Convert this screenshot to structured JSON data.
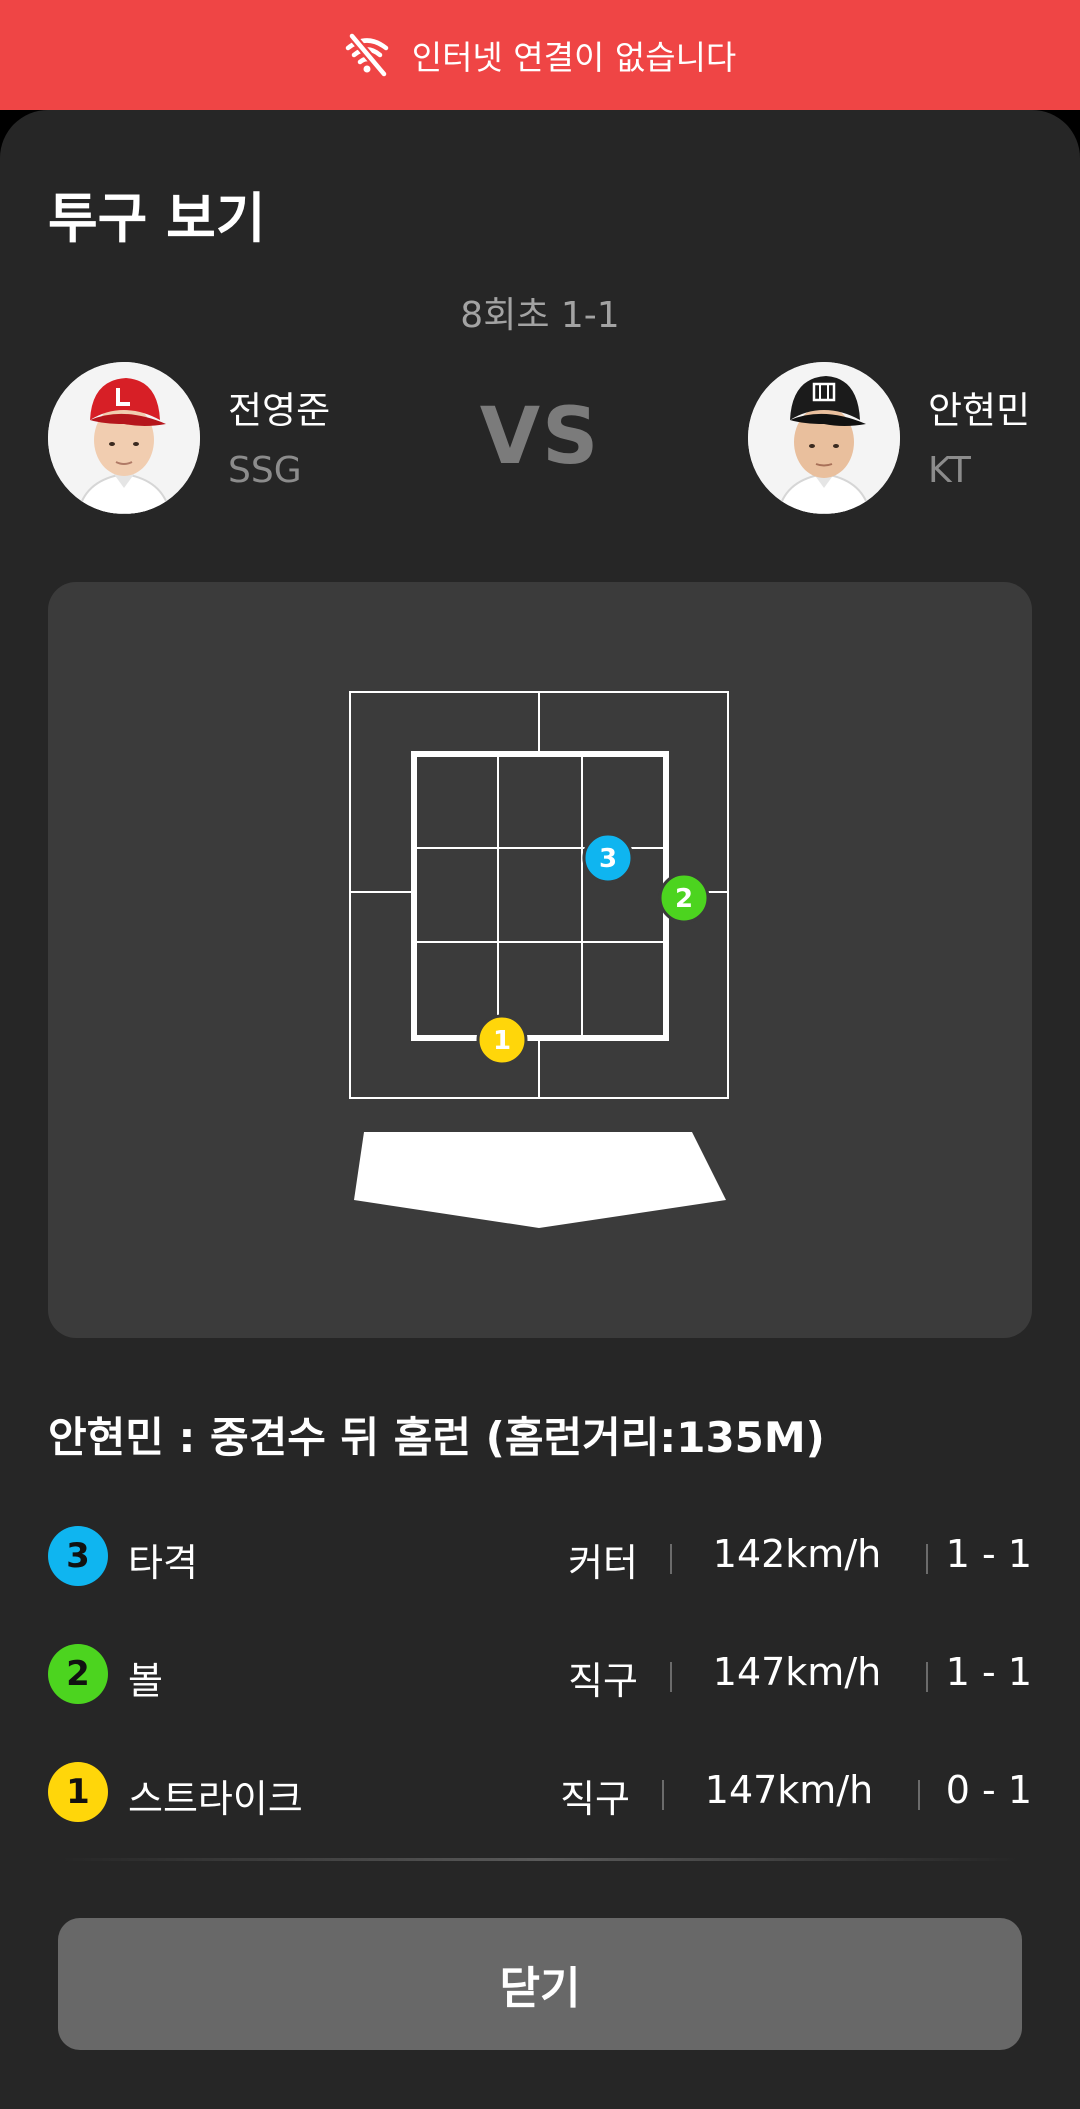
{
  "banner": {
    "text": "인터넷 연결이 없습니다",
    "icon": "wifi-off-icon",
    "color": "#ef4545"
  },
  "sheet": {
    "title": "투구 보기",
    "inning": "8회초 1-1",
    "vs_label": "VS",
    "pitcher": {
      "name": "전영준",
      "team": "SSG"
    },
    "batter": {
      "name": "안현민",
      "team": "KT"
    }
  },
  "zone": {
    "pitches": [
      {
        "number": "1",
        "color": "#ffd60a"
      },
      {
        "number": "2",
        "color": "#4cd41f"
      },
      {
        "number": "3",
        "color": "#0fb5f0"
      }
    ]
  },
  "result": "안현민 : 중견수 뒤 홈런 (홈런거리:135M)",
  "pitch_list": [
    {
      "number": "3",
      "label": "타격",
      "type": "커터",
      "speed": "142km/h",
      "count": "1 - 1",
      "color": "#0fb5f0"
    },
    {
      "number": "2",
      "label": "볼",
      "type": "직구",
      "speed": "147km/h",
      "count": "1 - 1",
      "color": "#4cd41f"
    },
    {
      "number": "1",
      "label": "스트라이크",
      "type": "직구",
      "speed": "147km/h",
      "count": "0 - 1",
      "color": "#ffd60a"
    }
  ],
  "close_label": "닫기"
}
